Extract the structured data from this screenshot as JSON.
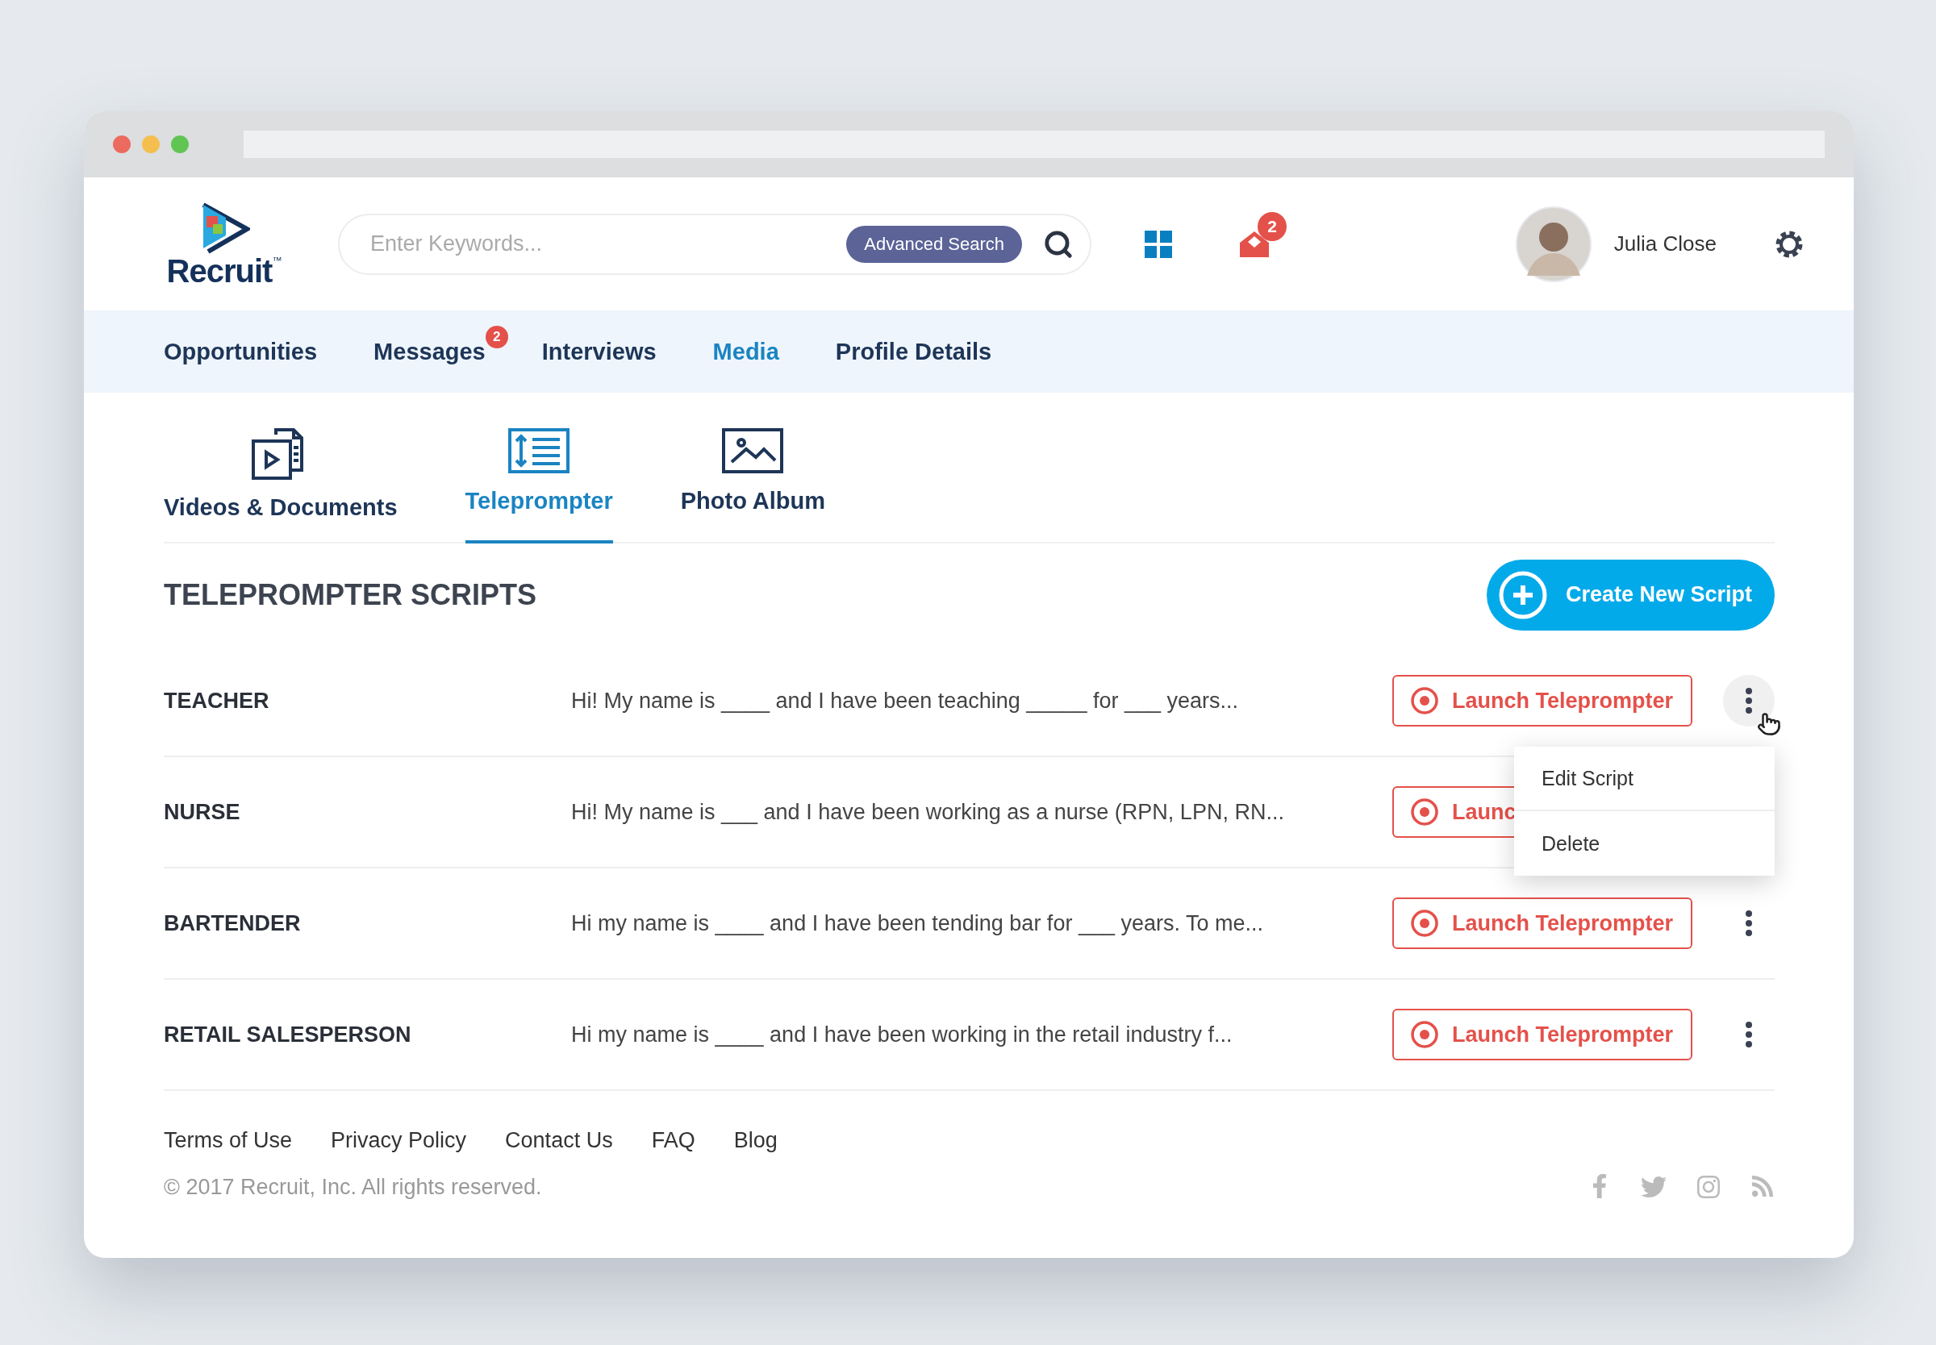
{
  "browser": {
    "controls": [
      {
        "color": "#ec6a5e"
      },
      {
        "color": "#f4bf4f"
      },
      {
        "color": "#61c554"
      }
    ]
  },
  "header": {
    "logo": {
      "text": "Recruit",
      "mark": "™"
    },
    "search": {
      "placeholder": "Enter Keywords...",
      "button": "Advanced Search"
    },
    "mail_badge": "2",
    "user": {
      "name": "Julia Close"
    }
  },
  "nav": [
    {
      "label": "Opportunities",
      "selected": false
    },
    {
      "label": "Messages",
      "selected": false,
      "badge": "2"
    },
    {
      "label": "Interviews",
      "selected": false
    },
    {
      "label": "Media",
      "selected": true
    },
    {
      "label": "Profile Details",
      "selected": false
    }
  ],
  "media_tabs": [
    {
      "label": "Videos & Documents",
      "kind": "videos",
      "selected": false
    },
    {
      "label": "Teleprompter",
      "kind": "teleprompter",
      "selected": true
    },
    {
      "label": "Photo Album",
      "kind": "photos",
      "selected": false
    }
  ],
  "section": {
    "title": "TELEPROMPTER SCRIPTS",
    "create_button": "Create New Script"
  },
  "scripts": [
    {
      "name": "TEACHER",
      "snippet": "Hi! My name is ____ and I have been teaching _____ for ___ years...",
      "button": "Launch Teleprompter",
      "menu_open": true
    },
    {
      "name": "NURSE",
      "snippet": "Hi! My name is ___ and I have been working as a nurse (RPN, LPN, RN...",
      "button": "Launc",
      "menu_open": false
    },
    {
      "name": "BARTENDER",
      "snippet": "Hi my name is ____ and I have been tending bar for ___ years. To me...",
      "button": "Launch Teleprompter",
      "menu_open": false
    },
    {
      "name": "RETAIL SALESPERSON",
      "snippet": "Hi my name is ____ and I have been working in the retail industry f...",
      "button": "Launch Teleprompter",
      "menu_open": false
    }
  ],
  "menu": {
    "items": [
      "Edit Script",
      "Delete"
    ]
  },
  "footer": {
    "links": [
      "Terms of Use",
      "Privacy Policy",
      "Contact Us",
      "FAQ",
      "Blog"
    ],
    "copyright": "© 2017 Recruit, Inc. All rights reserved."
  }
}
